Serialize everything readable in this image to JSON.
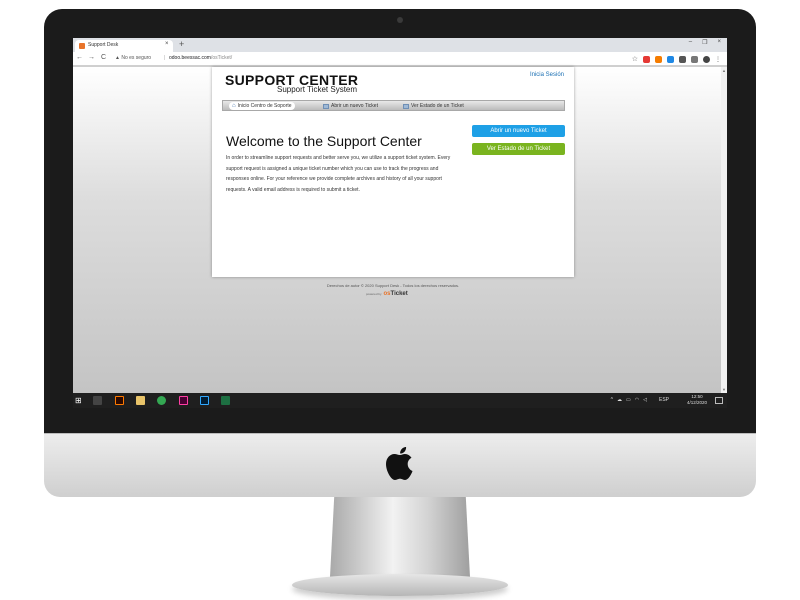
{
  "browser": {
    "tab_title": "Support Desk",
    "tab_close": "×",
    "new_tab": "+",
    "window_controls": [
      "–",
      "❐",
      "×"
    ],
    "nav": {
      "back": "←",
      "forward": "→",
      "reload": "C"
    },
    "security_label": "▲ No es seguro",
    "separator": "|",
    "url_host": "odoo.beessac.com",
    "url_path": "/osTicket/"
  },
  "page": {
    "logo_title": "SUPPORT CENTER",
    "logo_subtitle": "Support Ticket System",
    "sign_in": "Inicia Sesión",
    "nav": {
      "home": "Inicio Centro de Soporte",
      "open_ticket": "Abrir un nuevo Ticket",
      "check_status": "Ver Estado de un Ticket"
    },
    "welcome_title": "Welcome to the Support Center",
    "welcome_text": "In order to streamline support requests and better serve you, we utilize a support ticket system. Every support request is assigned a unique ticket number which you can use to track the progress and responses online. For your reference we provide complete archives and history of all your support requests. A valid email address is required to submit a ticket.",
    "button_open": "Abrir un nuevo Ticket",
    "button_check": "Ver Estado de un Ticket",
    "footer_copyright": "Derechos de autor © 2020 Support Desk - Todos los derechos reservados.",
    "powered_by": "powered by",
    "osticket_prefix": "os",
    "osticket_name": "Ticket"
  },
  "taskbar": {
    "language": "ESP",
    "time": "12:50",
    "date": "4/12/2020",
    "tray_arrow": "^"
  },
  "colors": {
    "accent_blue": "#1ea0e6",
    "accent_green": "#7ab41f",
    "link": "#1a6fb3",
    "osticket_orange": "#e8742b"
  }
}
